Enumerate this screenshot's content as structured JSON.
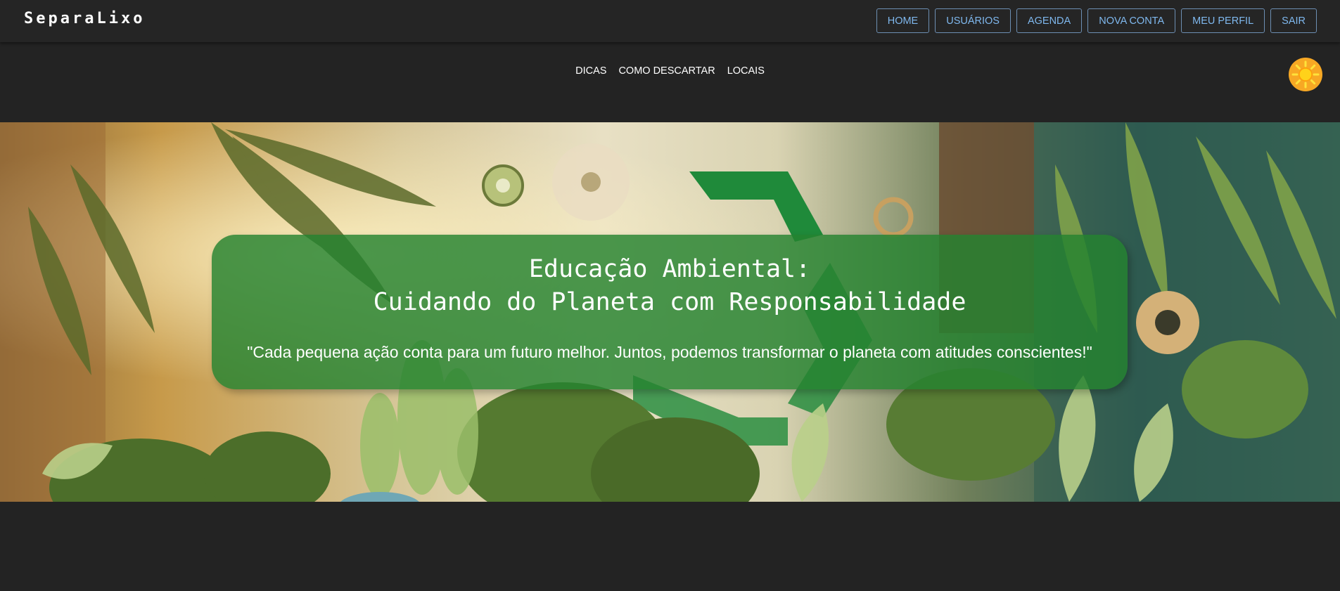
{
  "app": {
    "brand": "SeparaLixo"
  },
  "topnav": {
    "items": [
      {
        "label": "HOME"
      },
      {
        "label": "USUÁRIOS"
      },
      {
        "label": "AGENDA"
      },
      {
        "label": "NOVA CONTA"
      },
      {
        "label": "MEU PERFIL"
      },
      {
        "label": "SAIR"
      }
    ]
  },
  "subnav": {
    "items": [
      {
        "label": "DICAS"
      },
      {
        "label": "COMO DESCARTAR"
      },
      {
        "label": "LOCAIS"
      }
    ]
  },
  "theme_toggle": {
    "icon": "sun-icon"
  },
  "hero": {
    "title_line1": "Educação Ambiental:",
    "title_line2": "Cuidando do Planeta com Responsabilidade",
    "quote": "\"Cada pequena ação conta para um futuro melhor. Juntos, podemos transformar o planeta com atitudes conscientes!\"",
    "icon": "recycle-icon"
  },
  "colors": {
    "background": "#232323",
    "topbar": "#252525",
    "nav_text": "#7fb8ee",
    "nav_border": "#6d8fb3",
    "overlay": "#248230",
    "sun": "#f7a824"
  }
}
